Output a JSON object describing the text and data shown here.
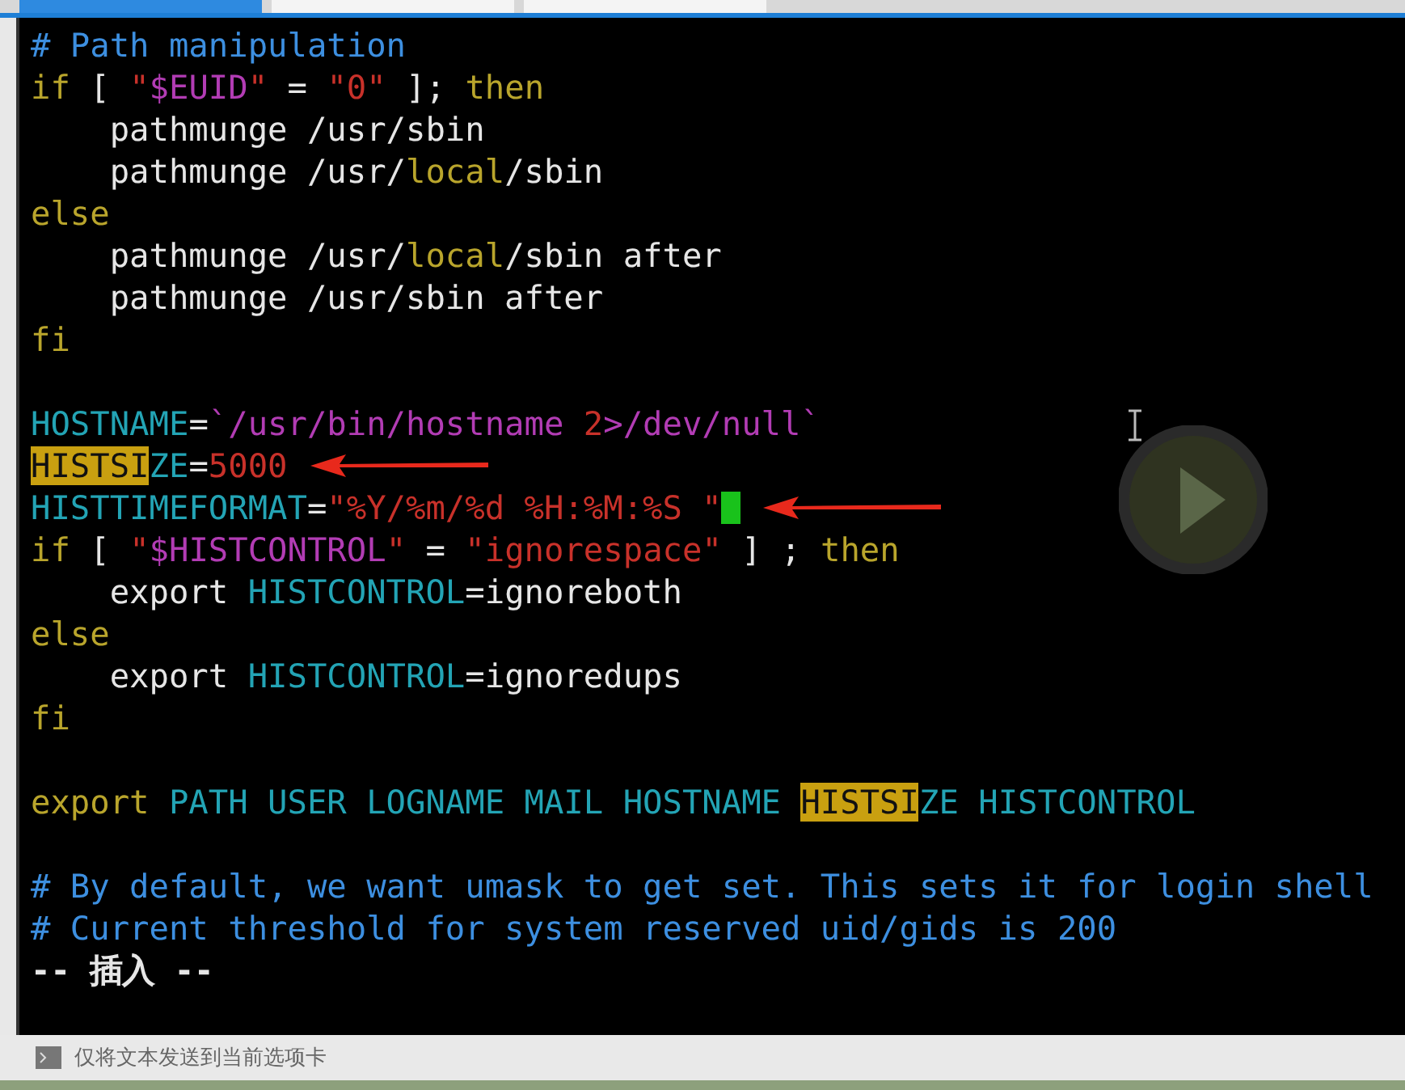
{
  "tabs": [
    {
      "selected": true
    },
    {
      "selected": false
    },
    {
      "selected": false
    }
  ],
  "editor": {
    "lines": [
      {
        "kind": "code",
        "segments": [
          {
            "kind": "comment",
            "text": "# Path manipulation"
          }
        ]
      },
      {
        "kind": "code",
        "segments": [
          {
            "kind": "keyword",
            "text": "if"
          },
          {
            "kind": "plain",
            "text": " [ "
          },
          {
            "kind": "string",
            "text": "\""
          },
          {
            "kind": "special",
            "text": "$EUID"
          },
          {
            "kind": "string",
            "text": "\""
          },
          {
            "kind": "plain",
            "text": " = "
          },
          {
            "kind": "string",
            "text": "\"0\""
          },
          {
            "kind": "plain",
            "text": " ]; "
          },
          {
            "kind": "keyword",
            "text": "then"
          }
        ]
      },
      {
        "kind": "code",
        "segments": [
          {
            "kind": "plain",
            "text": "    pathmunge /usr/sbin"
          }
        ]
      },
      {
        "kind": "code",
        "segments": [
          {
            "kind": "plain",
            "text": "    pathmunge /usr/"
          },
          {
            "kind": "keyword",
            "text": "local"
          },
          {
            "kind": "plain",
            "text": "/sbin"
          }
        ]
      },
      {
        "kind": "code",
        "segments": [
          {
            "kind": "keyword",
            "text": "else"
          }
        ]
      },
      {
        "kind": "code",
        "segments": [
          {
            "kind": "plain",
            "text": "    pathmunge /usr/"
          },
          {
            "kind": "keyword",
            "text": "local"
          },
          {
            "kind": "plain",
            "text": "/sbin after"
          }
        ]
      },
      {
        "kind": "code",
        "segments": [
          {
            "kind": "plain",
            "text": "    pathmunge /usr/sbin after"
          }
        ]
      },
      {
        "kind": "code",
        "segments": [
          {
            "kind": "keyword",
            "text": "fi"
          }
        ]
      },
      {
        "kind": "blank"
      },
      {
        "kind": "code",
        "segments": [
          {
            "kind": "variable",
            "text": "HOSTNAME"
          },
          {
            "kind": "plain",
            "text": "="
          },
          {
            "kind": "special",
            "text": "`/usr/bin/hostname "
          },
          {
            "kind": "string",
            "text": "2"
          },
          {
            "kind": "special",
            "text": ">/dev/null`"
          }
        ]
      },
      {
        "kind": "code",
        "arrow": true,
        "segments": [
          {
            "kind": "match",
            "text": "HISTSI"
          },
          {
            "kind": "variable",
            "text": "ZE"
          },
          {
            "kind": "plain",
            "text": "="
          },
          {
            "kind": "string",
            "text": "5000"
          }
        ]
      },
      {
        "kind": "code",
        "arrow": true,
        "cursor": true,
        "segments": [
          {
            "kind": "variable",
            "text": "HISTTIMEFORMAT"
          },
          {
            "kind": "plain",
            "text": "="
          },
          {
            "kind": "string",
            "text": "\"%Y/%m/%d %H:%M:%S \""
          }
        ]
      },
      {
        "kind": "code",
        "segments": [
          {
            "kind": "keyword",
            "text": "if"
          },
          {
            "kind": "plain",
            "text": " [ "
          },
          {
            "kind": "string",
            "text": "\""
          },
          {
            "kind": "special",
            "text": "$HISTCONTROL"
          },
          {
            "kind": "string",
            "text": "\""
          },
          {
            "kind": "plain",
            "text": " = "
          },
          {
            "kind": "string",
            "text": "\"ignorespace\""
          },
          {
            "kind": "plain",
            "text": " ] ; "
          },
          {
            "kind": "keyword",
            "text": "then"
          }
        ]
      },
      {
        "kind": "code",
        "segments": [
          {
            "kind": "plain",
            "text": "    export "
          },
          {
            "kind": "variable",
            "text": "HISTCONTROL"
          },
          {
            "kind": "plain",
            "text": "=ignoreboth"
          }
        ]
      },
      {
        "kind": "code",
        "segments": [
          {
            "kind": "keyword",
            "text": "else"
          }
        ]
      },
      {
        "kind": "code",
        "segments": [
          {
            "kind": "plain",
            "text": "    export "
          },
          {
            "kind": "variable",
            "text": "HISTCONTROL"
          },
          {
            "kind": "plain",
            "text": "=ignoredups"
          }
        ]
      },
      {
        "kind": "code",
        "segments": [
          {
            "kind": "keyword",
            "text": "fi"
          }
        ]
      },
      {
        "kind": "blank"
      },
      {
        "kind": "code",
        "segments": [
          {
            "kind": "keyword",
            "text": "export"
          },
          {
            "kind": "variable",
            "text": " PATH USER LOGNAME MAIL HOSTNAME "
          },
          {
            "kind": "match",
            "text": "HISTSI"
          },
          {
            "kind": "variable",
            "text": "ZE HISTCONTROL"
          }
        ]
      },
      {
        "kind": "blank"
      },
      {
        "kind": "code",
        "segments": [
          {
            "kind": "comment",
            "text": "# By default, we want umask to get set. This sets it for login shell"
          }
        ]
      },
      {
        "kind": "code",
        "segments": [
          {
            "kind": "comment",
            "text": "# Current threshold for system reserved uid/gids is 200"
          }
        ]
      },
      {
        "kind": "mode",
        "segments": [
          {
            "kind": "plain",
            "text": "-- 插入 --"
          }
        ]
      }
    ]
  },
  "status_bar": {
    "text": "仅将文本发送到当前选项卡"
  }
}
